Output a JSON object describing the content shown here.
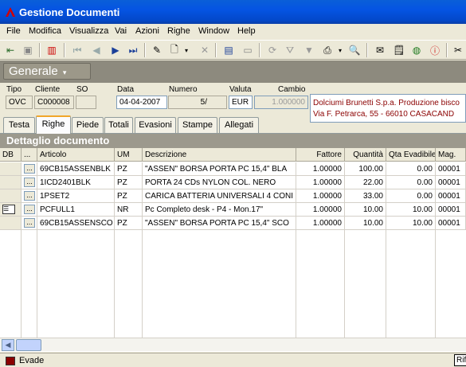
{
  "window": {
    "title": "Gestione Documenti"
  },
  "menu": [
    "File",
    "Modifica",
    "Visualizza",
    "Vai",
    "Azioni",
    "Righe",
    "Window",
    "Help"
  ],
  "section": {
    "label": "Generale"
  },
  "header_fields": {
    "tipo": {
      "label": "Tipo",
      "value": "OVC"
    },
    "cliente": {
      "label": "Cliente",
      "value": "C000008"
    },
    "so": {
      "label": "SO",
      "value": ""
    },
    "data": {
      "label": "Data",
      "value": "04-04-2007"
    },
    "numero": {
      "label": "Numero",
      "value": "5/"
    },
    "valuta": {
      "label": "Valuta",
      "value": "EUR"
    },
    "cambio": {
      "label": "Cambio",
      "value": "1.000000"
    }
  },
  "customer_info": {
    "line1": "Dolciumi Brunetti S.p.a. Produzione bisco",
    "line2": "Via F. Petrarca, 55 - 66010 CASACAND"
  },
  "tabs": [
    "Testa",
    "Righe",
    "Piede",
    "Totali",
    "Evasioni",
    "Stampe",
    "Allegati"
  ],
  "active_tab": "Righe",
  "panel": {
    "title": "Dettaglio documento"
  },
  "grid": {
    "columns": [
      "DB",
      "...",
      "Articolo",
      "UM",
      "Descrizione",
      "Fattore",
      "Quantità",
      "Qta Evadibile",
      "Mag."
    ],
    "rows": [
      {
        "db": "",
        "btn": "...",
        "articolo": "69CB15ASSENBLK",
        "um": "PZ",
        "descrizione": "\"ASSEN\" BORSA PORTA PC 15,4\" BLA",
        "fattore": "1.00000",
        "quantita": "100.00",
        "qta_evadibile": "0.00",
        "mag": "00001"
      },
      {
        "db": "",
        "btn": "...",
        "articolo": "1ICD2401BLK",
        "um": "PZ",
        "descrizione": "PORTA 24 CDs NYLON COL. NERO",
        "fattore": "1.00000",
        "quantita": "22.00",
        "qta_evadibile": "0.00",
        "mag": "00001"
      },
      {
        "db": "",
        "btn": "...",
        "articolo": "1PSET2",
        "um": "PZ",
        "descrizione": "CARICA BATTERIA UNIVERSALI 4 CONI",
        "fattore": "1.00000",
        "quantita": "33.00",
        "qta_evadibile": "0.00",
        "mag": "00001"
      },
      {
        "db": "db-icon",
        "btn": "...",
        "articolo": "PCFULL1",
        "um": "NR",
        "descrizione": "Pc Completo desk - P4 - Mon.17\"",
        "fattore": "1.00000",
        "quantita": "10.00",
        "qta_evadibile": "10.00",
        "mag": "00001"
      },
      {
        "db": "",
        "btn": "...",
        "articolo": "69CB15ASSENSCO",
        "um": "PZ",
        "descrizione": "\"ASSEN\" BORSA PORTA PC 15,4\" SCO",
        "fattore": "1.00000",
        "quantita": "10.00",
        "qta_evadibile": "10.00",
        "mag": "00001"
      }
    ]
  },
  "status": {
    "legend_label": "Evade",
    "legend_color": "#8b0000",
    "right_button": "Rif"
  },
  "colors": {
    "title_blue": "#0554e3",
    "section_gray": "#8d8a7e",
    "info_text": "#8b0000"
  }
}
